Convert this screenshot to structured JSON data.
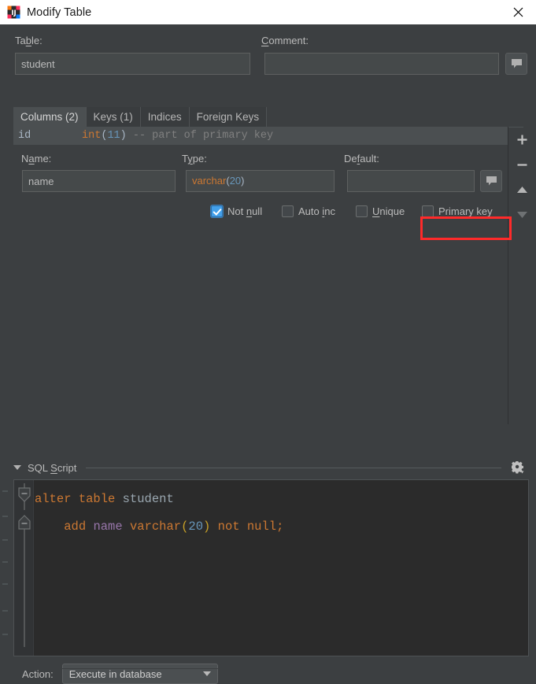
{
  "window": {
    "title": "Modify Table",
    "app_icon": "intellij-idea-icon",
    "close_icon": "close-icon"
  },
  "top": {
    "table_label": "Table:",
    "table_label_mnemonic": "b",
    "table_value": "student",
    "comment_label": "Comment:",
    "comment_label_mnemonic": "C",
    "comment_value": "",
    "comment_placeholder": "",
    "comment_button_icon": "speech-bubble-icon"
  },
  "tabs": [
    {
      "label": "Columns (2)",
      "selected": true
    },
    {
      "label": "Keys (1)",
      "selected": false
    },
    {
      "label": "Indices",
      "selected": false
    },
    {
      "label": "Foreign Keys",
      "selected": false
    }
  ],
  "column_list": {
    "rows": [
      {
        "name": "id",
        "type_keyword": "int",
        "type_args": "(11)",
        "type_length": "11",
        "comment": "-- part of primary key",
        "selected": true
      }
    ]
  },
  "column_editor": {
    "name_label": "Name:",
    "name_label_mnemonic": "a",
    "name_value": "name",
    "type_label": "Type:",
    "type_label_mnemonic": "y",
    "type_keyword": "varchar",
    "type_args_open": "(",
    "type_length": "20",
    "type_args_close": ")",
    "type_value": "varchar(20)",
    "default_label": "Default:",
    "default_label_mnemonic": "f",
    "default_value": "",
    "default_button_icon": "speech-bubble-icon",
    "checkboxes": [
      {
        "label": "Not null",
        "mnemonic": "n",
        "checked": true,
        "highlighted": false
      },
      {
        "label": "Auto inc",
        "mnemonic": "i",
        "checked": false,
        "highlighted": false
      },
      {
        "label": "Unique",
        "mnemonic": "U",
        "checked": false,
        "highlighted": false
      },
      {
        "label": "Primary key",
        "mnemonic": "P",
        "checked": false,
        "highlighted": true
      }
    ],
    "highlight_color": "#ff2a2a"
  },
  "side_toolbar": [
    {
      "icon": "plus-icon",
      "enabled": true
    },
    {
      "icon": "minus-icon",
      "enabled": true
    },
    {
      "icon": "arrow-up-icon",
      "enabled": true
    },
    {
      "icon": "arrow-down-icon",
      "enabled": false
    }
  ],
  "sql_section": {
    "title": "SQL Script",
    "title_mnemonic": "S",
    "collapse_icon": "chevron-down-icon",
    "settings_icon": "gear-icon",
    "code": {
      "line1": {
        "kw_alter": "alter",
        "space1": " ",
        "kw_table": "table",
        "space2": " ",
        "ident": "student"
      },
      "line2": {
        "indent": "    ",
        "kw_add": "add",
        "space1": " ",
        "col_name": "name",
        "space2": " ",
        "kw_type": "varchar",
        "paren_open": "(",
        "length": "20",
        "paren_close": ")",
        "space3": " ",
        "kw_not": "not",
        "space4": " ",
        "kw_null": "null;"
      }
    },
    "plain_text": "alter table student\n    add name varchar(20) not null;"
  },
  "action": {
    "label": "Action:",
    "value": "Execute in database",
    "arrow_icon": "chevron-down-icon"
  },
  "colors": {
    "background": "#3c3f41",
    "editor_background": "#2b2b2b",
    "accent_checked": "#43a0ea",
    "keyword": "#cc7832",
    "number": "#6897bb",
    "identifier": "#9876aa",
    "comment": "#808080",
    "highlight": "#ff2a2a"
  }
}
